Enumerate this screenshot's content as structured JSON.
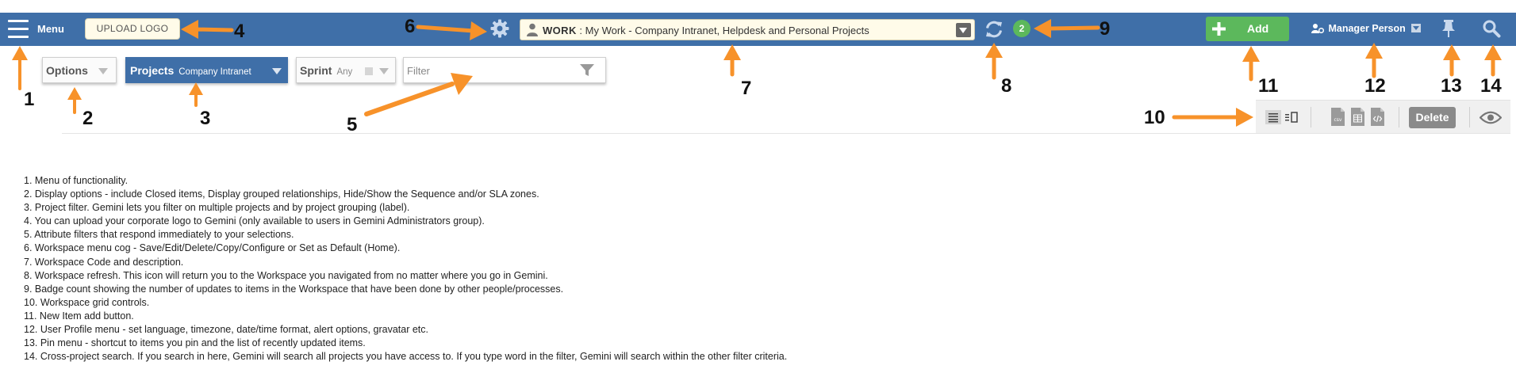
{
  "topbar": {
    "menu_label": "Menu",
    "upload_logo_label": "UPLOAD LOGO",
    "workspace": {
      "code": "WORK",
      "separator": ":",
      "description": "My Work - Company Intranet, Helpdesk and Personal Projects"
    },
    "badge_count": "2",
    "add_label": "Add",
    "user_name": "Manager Person",
    "icons": {
      "menu": "hamburger-menu-icon",
      "cog": "gear-icon",
      "user": "user-icon",
      "refresh": "refresh-icon",
      "plus": "plus-icon",
      "profile": "user-gear-icon",
      "pin": "pin-icon",
      "search": "search-icon"
    }
  },
  "filters": {
    "options_label": "Options",
    "projects_label": "Projects",
    "projects_value": "Company Intranet",
    "sprint_label": "Sprint",
    "sprint_value": "Any",
    "filter_placeholder": "Filter"
  },
  "grid_controls": {
    "icons": [
      "list-view-icon",
      "card-view-icon",
      "csv-export-icon",
      "excel-export-icon",
      "xml-export-icon",
      "eye-icon"
    ],
    "csv_label": "csv",
    "delete_label": "Delete"
  },
  "callouts": [
    "1",
    "2",
    "3",
    "4",
    "5",
    "6",
    "7",
    "8",
    "9",
    "10",
    "11",
    "12",
    "13",
    "14"
  ],
  "legend": [
    "1. Menu of functionality.",
    "2. Display options - include Closed items, Display grouped relationships, Hide/Show the Sequence and/or SLA zones.",
    "3. Project filter. Gemini lets you filter on multiple projects and by project grouping (label).",
    "4. You can upload your corporate logo to Gemini (only available to users in Gemini Administrators group).",
    "5. Attribute filters that respond immediately to your selections.",
    "6. Workspace menu cog - Save/Edit/Delete/Copy/Configure or Set as Default (Home).",
    "7. Workspace Code and description.",
    "8. Workspace refresh. This icon will return you to the Workspace you navigated from no matter where you go in Gemini.",
    "9. Badge count showing the number of updates to items in the Workspace that have been done by other people/processes.",
    "10. Workspace grid controls.",
    "11. New Item add button.",
    "12. User Profile menu - set language, timezone, date/time format, alert options, gravatar etc.",
    "13. Pin menu - shortcut to items you pin and the list of recently updated items.",
    "14. Cross-project search. If you search in here, Gemini will search all projects you have access to. If you type  word in the filter, Gemini will search within the other filter criteria."
  ],
  "colors": {
    "topbar": "#3f6fa8",
    "accent_orange": "#f7922a",
    "add_green": "#5cb85c",
    "field_bg": "#fffbe9"
  }
}
